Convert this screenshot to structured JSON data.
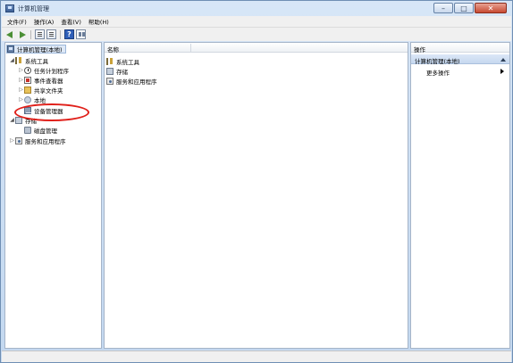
{
  "window": {
    "title": "计算机管理",
    "minimize_glyph": "–",
    "maximize_glyph": "□",
    "close_glyph": "✕"
  },
  "menu": [
    "文件(F)",
    "操作(A)",
    "查看(V)",
    "帮助(H)"
  ],
  "toolbar": {
    "icons": [
      "back-icon",
      "forward-icon",
      "show-hide-tree-icon",
      "export-list-icon",
      "help-icon",
      "show-pane-icon"
    ],
    "help_glyph": "?"
  },
  "tree": {
    "root": "计算机管理(本地)",
    "system_tools": "系统工具",
    "task_scheduler": "任务计划程序",
    "event_viewer": "事件查看器",
    "shared_folders": "共享文件夹",
    "local_users": "本地",
    "device_manager": "设备管理器",
    "storage": "存储",
    "disk_management": "磁盘管理",
    "services_apps": "服务和应用程序"
  },
  "middle": {
    "column_name": "名称",
    "items": [
      "系统工具",
      "存储",
      "服务和应用程序"
    ]
  },
  "actions": {
    "header": "操作",
    "section": "计算机管理(本地)",
    "more_actions": "更多操作"
  },
  "colors": {
    "annotation_circle": "#e0201a",
    "title_gradient_top": "#d7e6f7",
    "selection": "#dde8f6"
  }
}
